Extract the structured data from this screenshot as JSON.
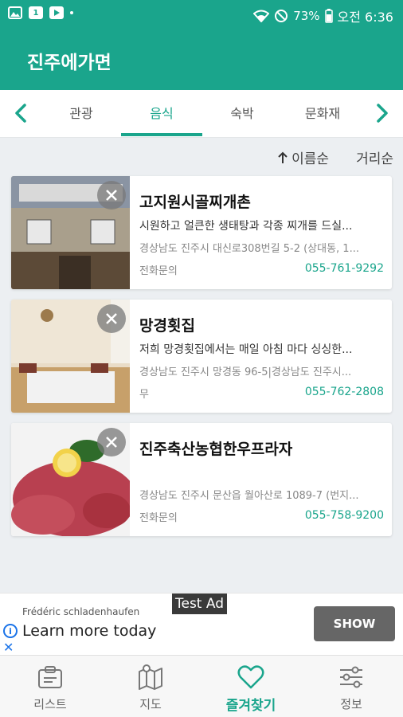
{
  "status_bar": {
    "battery": "73%",
    "time": "오전 6:36",
    "notification_badge": "1"
  },
  "app": {
    "title": "진주에가면"
  },
  "tabs": {
    "items": [
      {
        "label": "관광"
      },
      {
        "label": "음식"
      },
      {
        "label": "숙박"
      },
      {
        "label": "문화재"
      }
    ],
    "active_index": 1
  },
  "sort": {
    "by_name": "이름순",
    "by_distance": "거리순"
  },
  "places": [
    {
      "title": "고지원시골찌개촌",
      "description": "시원하고 얼큰한 생태탕과 각종 찌개를 드실...",
      "address": "경상남도 진주시 대신로308번길 5-2 (상대동, 1...",
      "phone_label": "전화문의",
      "phone": "055-761-9292"
    },
    {
      "title": "망경횟집",
      "description": "저희 망경횟집에서는 매일 아침 마다 싱싱한...",
      "address": "경상남도 진주시 망경동 96-5|경상남도 진주시...",
      "phone_label": "무",
      "phone": "055-762-2808"
    },
    {
      "title": "진주축산농협한우프라자",
      "description": "",
      "address": "경상남도 진주시 문산읍 월아산로 1089-7 (번지...",
      "phone_label": "전화문의",
      "phone": "055-758-9200"
    }
  ],
  "ad": {
    "badge": "Test Ad",
    "advertiser": "Frédéric schladenhaufen",
    "headline": "Learn more today",
    "cta": "SHOW"
  },
  "bottom_nav": {
    "items": [
      {
        "label": "리스트",
        "icon": "clipboard-icon"
      },
      {
        "label": "지도",
        "icon": "map-icon"
      },
      {
        "label": "즐겨찾기",
        "icon": "heart-icon"
      },
      {
        "label": "정보",
        "icon": "sliders-icon"
      }
    ],
    "active_index": 2
  },
  "colors": {
    "primary": "#1aa58c",
    "background": "#eceff2"
  }
}
